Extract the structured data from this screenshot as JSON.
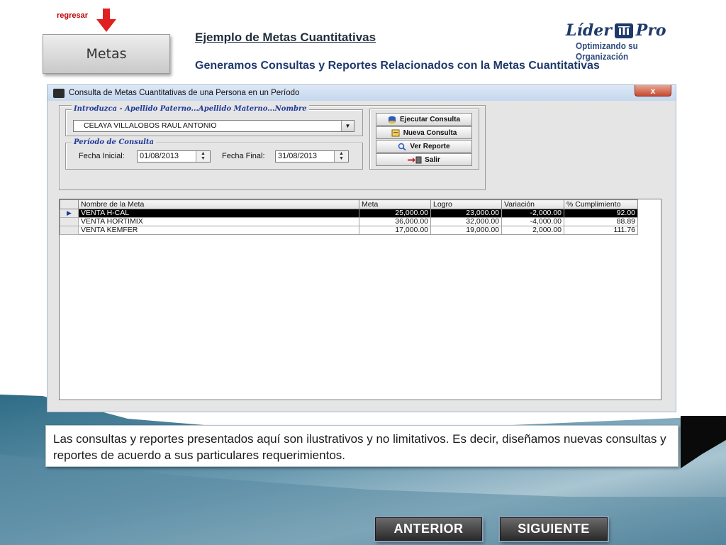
{
  "nav": {
    "back_label": "regresar",
    "metas_label": "Metas"
  },
  "header": {
    "title": "Ejemplo de Metas Cuantitativas",
    "subtitle": "Generamos Consultas y Reportes Relacionados con la Metas Cuantitativas"
  },
  "logo": {
    "name": "Líder Pro",
    "name_a": "Líder",
    "name_b": "Pro",
    "tagline": "Optimizando su Organización"
  },
  "window": {
    "title": "Consulta de Metas Cuantitativas de una Persona en un Período",
    "close_label": "x",
    "person_group_label": "Introduzca - Apellido Paterno...Apellido Materno...Nombre",
    "person_value": "CELAYA VILLALOBOS RAUL ANTONIO",
    "period_group_label": "Período de Consulta",
    "start_label": "Fecha Inicial:",
    "start_value": "01/08/2013",
    "end_label": "Fecha Final:",
    "end_value": "31/08/2013",
    "buttons": {
      "execute": "Ejecutar Consulta",
      "new": "Nueva Consulta",
      "report": "Ver Reporte",
      "exit": "Salir"
    },
    "grid": {
      "headers": [
        "Nombre de la Meta",
        "Meta",
        "Logro",
        "Variación",
        "% Cumplimiento"
      ],
      "rows": [
        [
          "VENTA H-CAL",
          "25,000.00",
          "23,000.00",
          "-2,000.00",
          "92.00"
        ],
        [
          "VENTA HORTIMIX",
          "36,000.00",
          "32,000.00",
          "-4,000.00",
          "88.89"
        ],
        [
          "VENTA KEMFER",
          "17,000.00",
          "19,000.00",
          "2,000.00",
          "111.76"
        ]
      ]
    }
  },
  "note": "Las consultas y reportes presentados aquí son ilustrativos y no limitativos. Es decir, diseñamos nuevas consultas y reportes de acuerdo a sus particulares requerimientos.",
  "footer": {
    "prev_label": "ANTERIOR",
    "next_label": "SIGUIENTE"
  },
  "colors": {
    "accent": "#1f3a6a",
    "arrow": "#e02020",
    "background_band": "#4b7f98",
    "selected_row": "#000000"
  }
}
